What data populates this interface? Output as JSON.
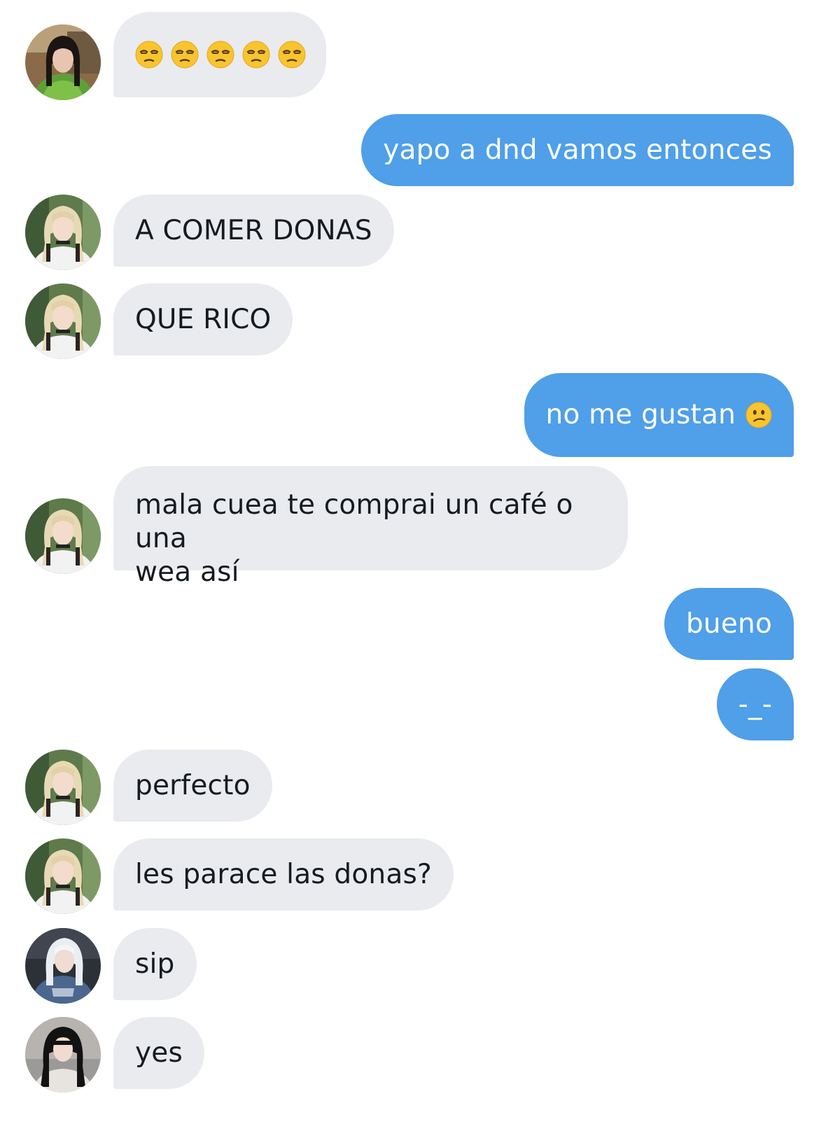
{
  "conversation": {
    "messages": [
      {
        "sender": "other",
        "avatar": "avatar-user-green-jacket",
        "emoji": [
          "unamused-face-icon",
          "unamused-face-icon",
          "unamused-face-icon",
          "unamused-face-icon",
          "unamused-face-icon"
        ]
      },
      {
        "sender": "me",
        "text": "yapo a dnd vamos entonces"
      },
      {
        "sender": "other",
        "avatar": "avatar-user-blonde",
        "text": "A COMER DONAS"
      },
      {
        "sender": "other",
        "avatar": "avatar-user-blonde",
        "text": "QUE RICO"
      },
      {
        "sender": "me",
        "text": "no me gustan",
        "emoji": "confused-face-icon"
      },
      {
        "sender": "other",
        "avatar": "avatar-user-blonde",
        "line1": "mala cuea te comprai un café o una",
        "line2": "wea así"
      },
      {
        "sender": "me",
        "text": "bueno"
      },
      {
        "sender": "me",
        "text": "-_-"
      },
      {
        "sender": "other",
        "avatar": "avatar-user-blonde",
        "text": "perfecto"
      },
      {
        "sender": "other",
        "avatar": "avatar-user-blonde",
        "text": "les parace las donas?"
      },
      {
        "sender": "other",
        "avatar": "avatar-user-white-hair",
        "text": "sip"
      },
      {
        "sender": "other",
        "avatar": "avatar-user-dark-hair",
        "text": "yes"
      }
    ]
  },
  "colors": {
    "incoming_bubble": "#e9ebef",
    "outgoing_bubble": "#4f9fe9",
    "incoming_text": "#161b21",
    "outgoing_text": "#ffffff"
  }
}
